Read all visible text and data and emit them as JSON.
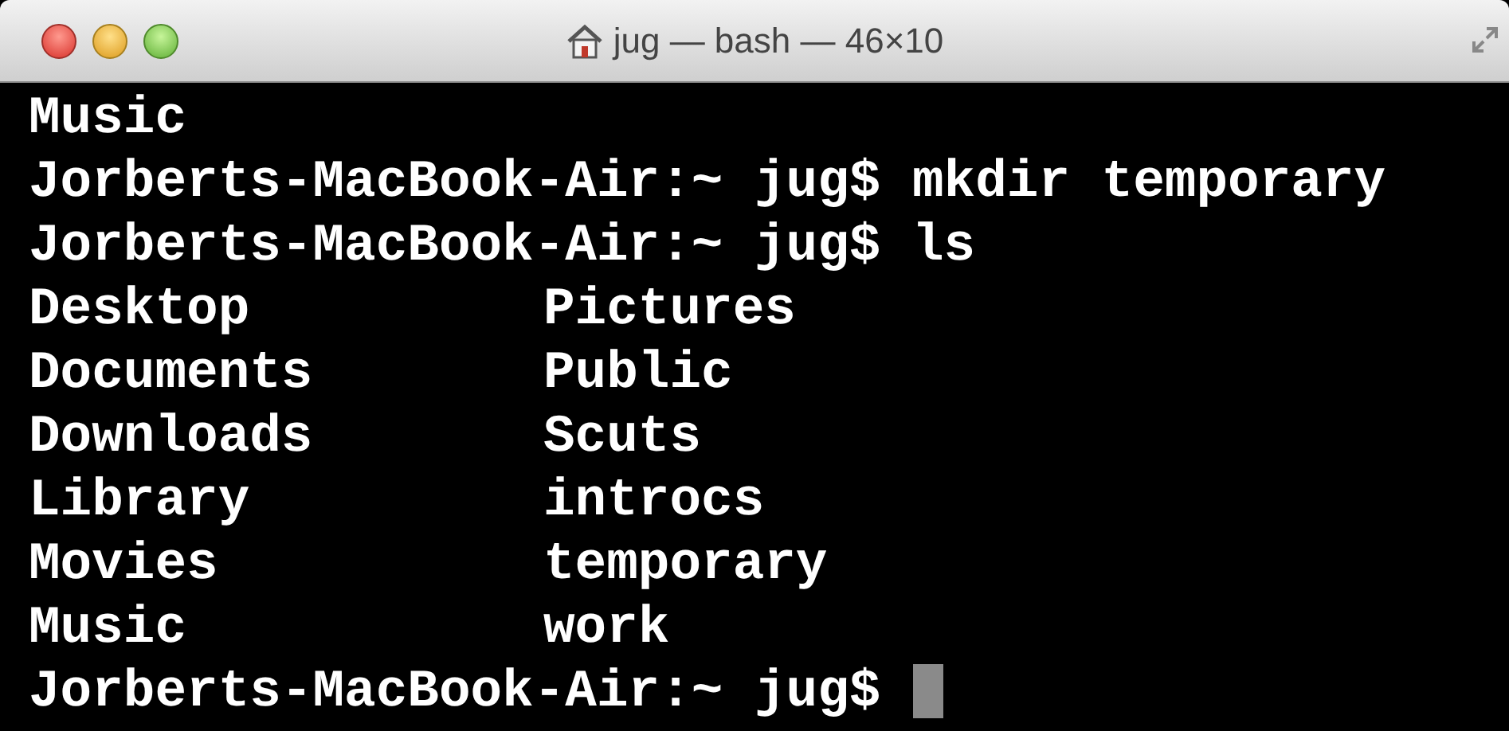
{
  "window": {
    "title": "jug — bash — 46×10"
  },
  "terminal": {
    "lines": [
      {
        "kind": "text",
        "text": "Music"
      },
      {
        "kind": "text",
        "text": "Jorberts-MacBook-Air:~ jug$ mkdir temporary"
      },
      {
        "kind": "text",
        "text": "Jorberts-MacBook-Air:~ jug$ ls"
      },
      {
        "kind": "columns",
        "columns": [
          "Desktop",
          "Pictures"
        ]
      },
      {
        "kind": "columns",
        "columns": [
          "Documents",
          "Public"
        ]
      },
      {
        "kind": "columns",
        "columns": [
          "Downloads",
          "Scuts"
        ]
      },
      {
        "kind": "columns",
        "columns": [
          "Library",
          "introcs"
        ]
      },
      {
        "kind": "columns",
        "columns": [
          "Movies",
          "temporary"
        ]
      },
      {
        "kind": "columns",
        "columns": [
          "Music",
          "work"
        ]
      },
      {
        "kind": "prompt",
        "text": "Jorberts-MacBook-Air:~ jug$"
      }
    ]
  }
}
